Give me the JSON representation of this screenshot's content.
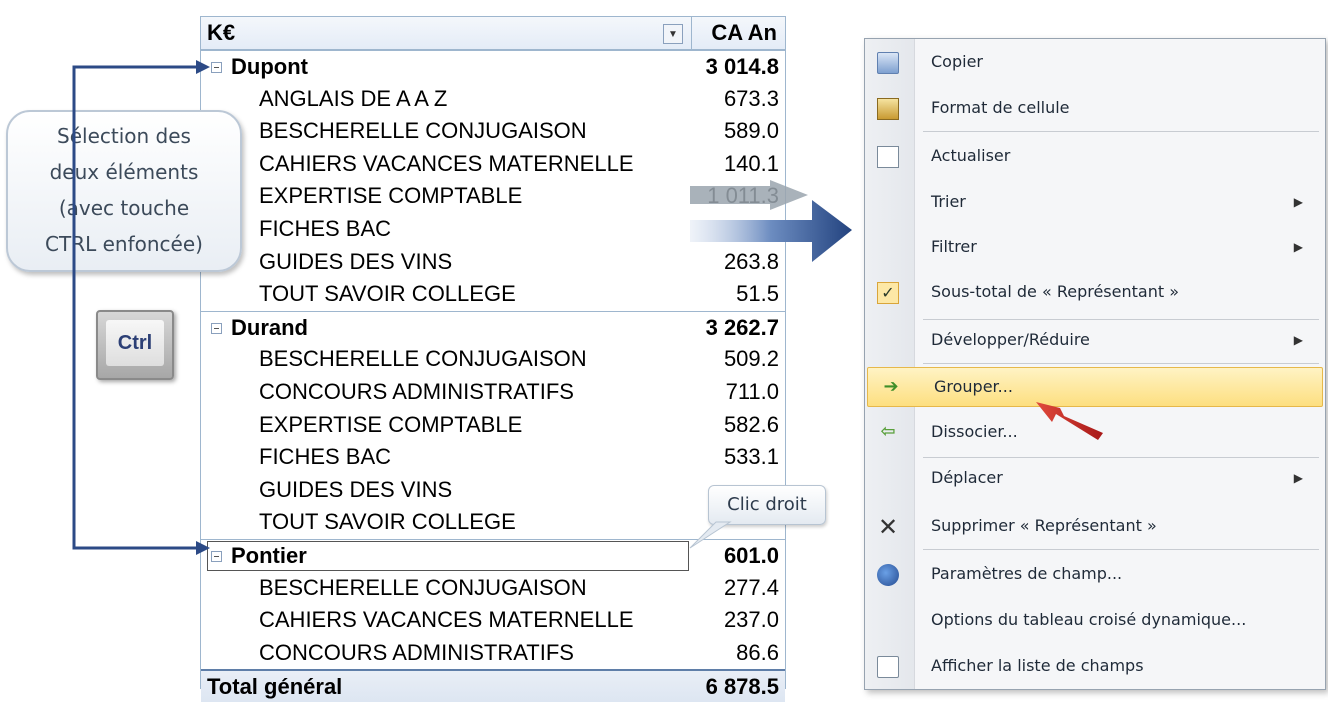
{
  "pivot": {
    "header": {
      "left": "K€",
      "right": "CA An",
      "dropdown_glyph": "▼"
    },
    "rows": [
      {
        "type": "group",
        "label": "Dupont",
        "value": "3 014.8"
      },
      {
        "type": "item",
        "label": "ANGLAIS DE A A Z",
        "value": "673.3"
      },
      {
        "type": "item",
        "label": "BESCHERELLE CONJUGAISON",
        "value": "589.0"
      },
      {
        "type": "item",
        "label": "CAHIERS VACANCES MATERNELLE",
        "value": "140.1"
      },
      {
        "type": "item",
        "label": "EXPERTISE COMPTABLE",
        "value": "1 011.3"
      },
      {
        "type": "item",
        "label": "FICHES BAC",
        "value": ""
      },
      {
        "type": "item",
        "label": "GUIDES DES VINS",
        "value": "263.8"
      },
      {
        "type": "item",
        "label": "TOUT SAVOIR COLLEGE",
        "value": "51.5"
      },
      {
        "type": "group",
        "label": "Durand",
        "value": "3 262.7"
      },
      {
        "type": "item",
        "label": "BESCHERELLE CONJUGAISON",
        "value": "509.2"
      },
      {
        "type": "item",
        "label": "CONCOURS ADMINISTRATIFS",
        "value": "711.0"
      },
      {
        "type": "item",
        "label": "EXPERTISE COMPTABLE",
        "value": "582.6"
      },
      {
        "type": "item",
        "label": "FICHES BAC",
        "value": "533.1"
      },
      {
        "type": "item",
        "label": "GUIDES DES VINS",
        "value": ""
      },
      {
        "type": "item",
        "label": "TOUT SAVOIR COLLEGE",
        "value": ""
      },
      {
        "type": "group",
        "label": "Pontier",
        "value": "601.0",
        "selected": true
      },
      {
        "type": "item",
        "label": "BESCHERELLE CONJUGAISON",
        "value": "277.4"
      },
      {
        "type": "item",
        "label": "CAHIERS VACANCES MATERNELLE",
        "value": "237.0"
      },
      {
        "type": "item",
        "label": "CONCOURS ADMINISTRATIFS",
        "value": "86.6"
      },
      {
        "type": "total",
        "label": "Total général",
        "value": "6 878.5"
      }
    ]
  },
  "callout": {
    "lines": [
      "Sélection des",
      "deux éléments",
      "(avec touche",
      "CTRL enfoncée)"
    ]
  },
  "ctrl_key": {
    "label": "Ctrl"
  },
  "clic_droit": {
    "label": "Clic droit"
  },
  "menu": {
    "items": [
      {
        "label": "Copier",
        "icon": "copy-icon",
        "submenu": false
      },
      {
        "label": "Format de cellule",
        "icon": "format-cells-icon",
        "submenu": false
      },
      {
        "label": "Actualiser",
        "icon": "refresh-icon",
        "submenu": false
      },
      {
        "label": "Trier",
        "icon": "",
        "submenu": true
      },
      {
        "label": "Filtrer",
        "icon": "",
        "submenu": true
      },
      {
        "label": "Sous-total de « Représentant »",
        "icon": "checkmark-icon",
        "submenu": false
      },
      {
        "label": "Développer/Réduire",
        "icon": "",
        "submenu": true
      },
      {
        "label": "Grouper...",
        "icon": "group-icon",
        "submenu": false,
        "highlighted": true
      },
      {
        "label": "Dissocier...",
        "icon": "ungroup-icon",
        "submenu": false
      },
      {
        "label": "Déplacer",
        "icon": "",
        "submenu": true
      },
      {
        "label": "Supprimer « Représentant »",
        "icon": "delete-icon",
        "submenu": false
      },
      {
        "label": "Paramètres de champ...",
        "icon": "field-settings-icon",
        "submenu": false
      },
      {
        "label": "Options du tableau croisé dynamique...",
        "icon": "",
        "submenu": false
      },
      {
        "label": "Afficher la liste de champs",
        "icon": "field-list-icon",
        "submenu": false
      }
    ],
    "submenu_glyph": "▶",
    "check_glyph": "✓"
  },
  "colors": {
    "highlight": "#fddf80",
    "connector_blue": "#2c4a86",
    "pointer_red": "#c0282a"
  }
}
